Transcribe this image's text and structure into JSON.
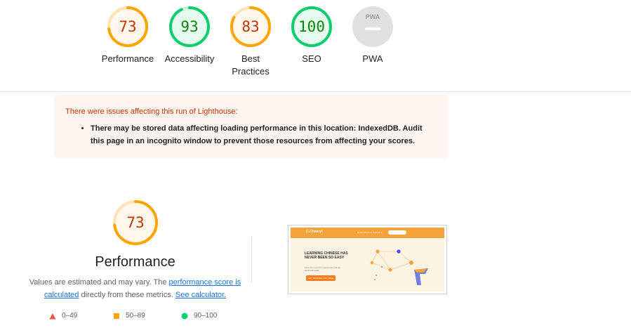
{
  "colors": {
    "average": "#ffa400",
    "average_text": "#c33300",
    "pass": "#0cce6b",
    "pass_text": "#008800",
    "fail": "#ff4e42",
    "na": "#e0e0e0",
    "link": "#1a73e8",
    "warning_bg": "#fff5f0",
    "warning_text": "#c33300",
    "screenshot_orange": "#f5a23a"
  },
  "gauges": [
    {
      "id": "performance",
      "score": "73",
      "label": "Performance",
      "status": "average"
    },
    {
      "id": "accessibility",
      "score": "93",
      "label": "Accessibility",
      "status": "pass"
    },
    {
      "id": "best-practices",
      "score": "83",
      "label_line1": "Best",
      "label_line2": "Practices",
      "status": "average"
    },
    {
      "id": "seo",
      "score": "100",
      "label": "SEO",
      "status": "pass"
    },
    {
      "id": "pwa",
      "score": "",
      "label": "PWA",
      "badge_text": "PWA",
      "status": "na"
    }
  ],
  "warning": {
    "title": "There were issues affecting this run of Lighthouse:",
    "items": [
      "There may be stored data affecting loading performance in this location: IndexedDB. Audit this page in an incognito window to prevent those resources from affecting your scores."
    ]
  },
  "performance": {
    "score": "73",
    "title": "Performance",
    "desc_prefix": "Values are estimated and may vary. The",
    "link1": "performance score is calculated",
    "desc_mid": "directly from these metrics.",
    "link2": "See calculator."
  },
  "legend": [
    {
      "shape": "triangle",
      "range": "0–49",
      "color_key": "fail"
    },
    {
      "shape": "square",
      "range": "50–89",
      "color_key": "average"
    },
    {
      "shape": "circle",
      "range": "90–100",
      "color_key": "pass"
    }
  ],
  "screenshot": {
    "logo": "C-Cheery!",
    "nav_links": "Home   About Us   Courses ▾",
    "nav_button": "TRY A FREE CLASS",
    "hero_title": "LEARNING CHINESE HAS NEVER BEEN SO EASY",
    "hero_sub": "Find out more from experts around the world with ease",
    "hero_button": "GET STARTED FOR FREE"
  }
}
